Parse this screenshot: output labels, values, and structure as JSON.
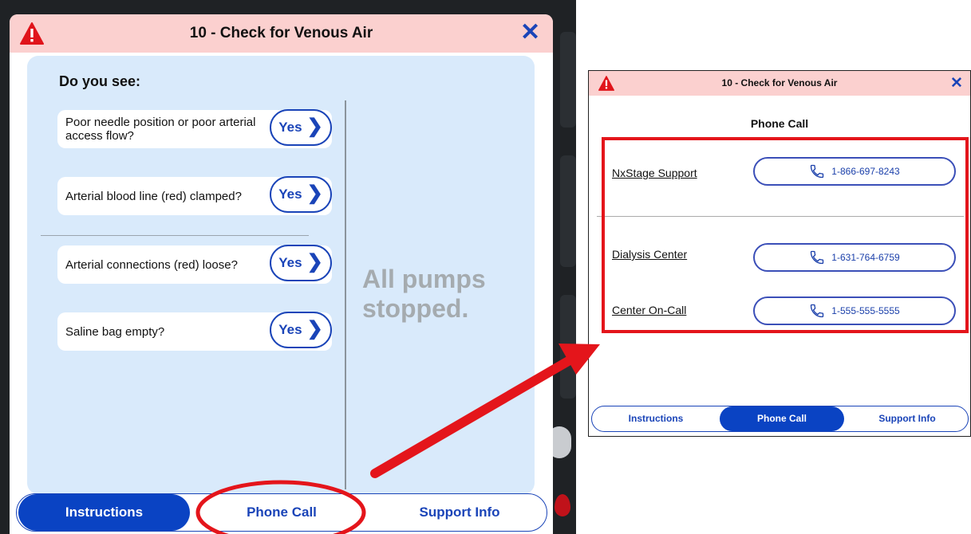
{
  "main_dialog": {
    "title": "10 - Check for Venous Air",
    "prompt": "Do you see:",
    "questions": [
      {
        "text": "Poor needle position or poor arterial access flow?",
        "button": "Yes"
      },
      {
        "text": "Arterial blood line (red) clamped?",
        "button": "Yes"
      },
      {
        "text": "Arterial connections (red) loose?",
        "button": "Yes"
      },
      {
        "text": "Saline bag empty?",
        "button": "Yes"
      }
    ],
    "status": "All pumps stopped.",
    "tabs": [
      "Instructions",
      "Phone Call",
      "Support Info"
    ],
    "active_tab": "Instructions"
  },
  "phone_dialog": {
    "title": "10 - Check for Venous Air",
    "subtitle": "Phone Call",
    "contacts": [
      {
        "label": "NxStage Support",
        "phone": "1-866-697-8243"
      },
      {
        "label": "Dialysis Center",
        "phone": "1-631-764-6759"
      },
      {
        "label": "Center On-Call",
        "phone": "1-555-555-5555"
      }
    ],
    "tabs": [
      "Instructions",
      "Phone Call",
      "Support Info"
    ],
    "active_tab": "Phone Call"
  },
  "colors": {
    "header_bg": "#fbd0cf",
    "accent_blue": "#1a44b8",
    "active_tab": "#0a43c3",
    "panel_bg": "#d9eafb",
    "annotation_red": "#e4151b",
    "warning_red": "#e0141b"
  },
  "icons": [
    "warning-icon",
    "close-icon",
    "chevron-right-icon",
    "phone-icon"
  ]
}
